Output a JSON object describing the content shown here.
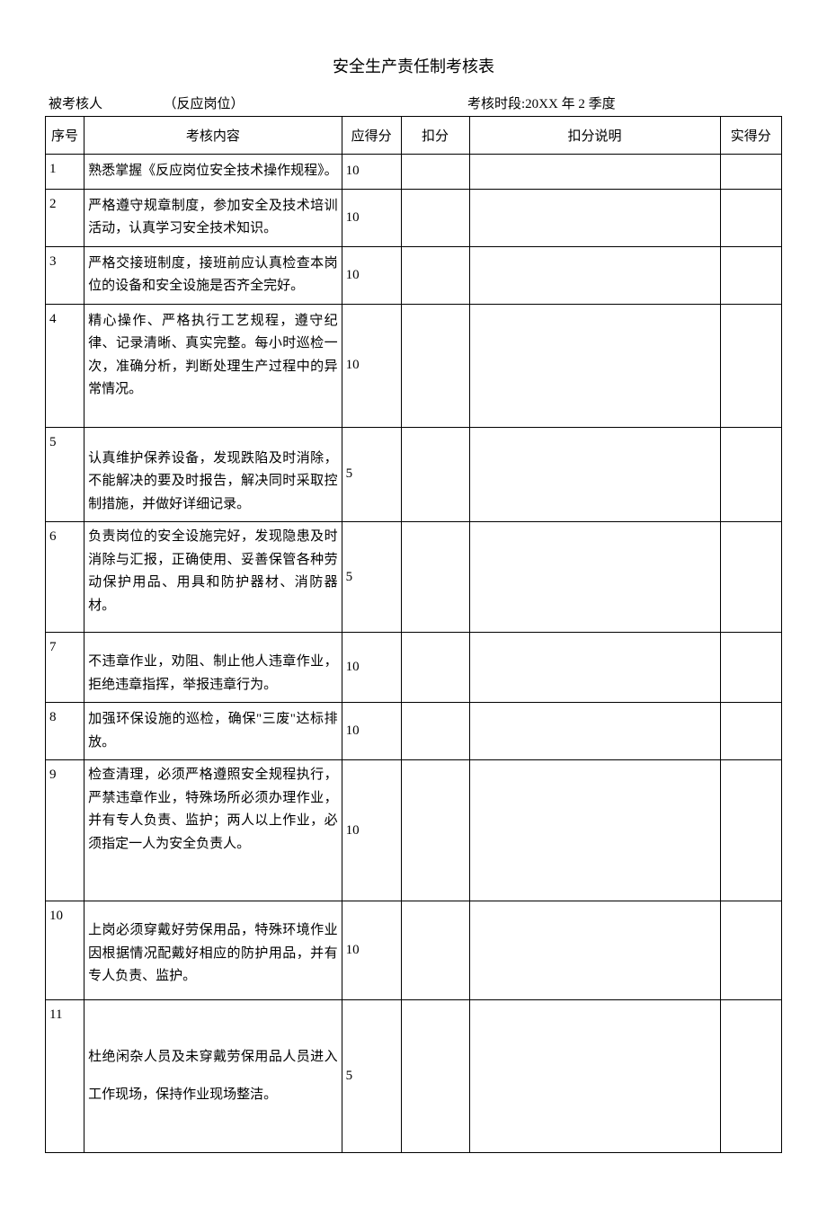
{
  "title": "安全生产责任制考核表",
  "info": {
    "assessee_label": "被考核人",
    "post_label": "（反应岗位）",
    "period_label": "考核时段:",
    "period_value": "20XX 年 2 季度"
  },
  "headers": {
    "seq": "序号",
    "content": "考核内容",
    "score": "应得分",
    "deduct": "扣分",
    "reason": "扣分说明",
    "actual": "实得分"
  },
  "rows": [
    {
      "seq": "1",
      "content": "熟悉掌握《反应岗位安全技术操作规程》。",
      "score": "10"
    },
    {
      "seq": "2",
      "content": "严格遵守规章制度，参加安全及技术培训活动，认真学习安全技术知识。",
      "score": "10"
    },
    {
      "seq": "3",
      "content": "严格交接班制度，接班前应认真检查本岗位的设备和安全设施是否齐全完好。",
      "score": "10"
    },
    {
      "seq": "4",
      "content": "精心操作、严格执行工艺规程，遵守纪律、记录清晰、真实完整。每小时巡检一次，准确分析，判断处理生产过程中的异常情况。",
      "score": "10"
    },
    {
      "seq": "5",
      "content": "认真维护保养设备，发现跌陷及时消除，不能解决的要及时报告，解决同时采取控制措施，并做好详细记录。",
      "score": "5"
    },
    {
      "seq": "6",
      "content": "负责岗位的安全设施完好，发现隐患及时消除与汇报，正确使用、妥善保管各种劳动保护用品、用具和防护器材、消防器材。",
      "score": "5"
    },
    {
      "seq": "7",
      "content": "不违章作业，劝阻、制止他人违章作业，拒绝违章指挥，举报违章行为。",
      "score": "10"
    },
    {
      "seq": "8",
      "content": "加强环保设施的巡检，确保\"三废\"达标排放。",
      "score": "10"
    },
    {
      "seq": "9",
      "content": "检查清理，必须严格遵照安全规程执行，严禁违章作业，特殊场所必须办理作业，并有专人负责、监护；两人以上作业，必须指定一人为安全负责人。",
      "score": "10"
    },
    {
      "seq": "10",
      "content": "上岗必须穿戴好劳保用品，特殊环境作业因根据情况配戴好相应的防护用品，并有专人负责、监护。",
      "score": "10"
    },
    {
      "seq": "11",
      "content": "杜绝闲杂人员及未穿戴劳保用品人员进入工作现场，保持作业现场整洁。",
      "score": "5"
    }
  ]
}
